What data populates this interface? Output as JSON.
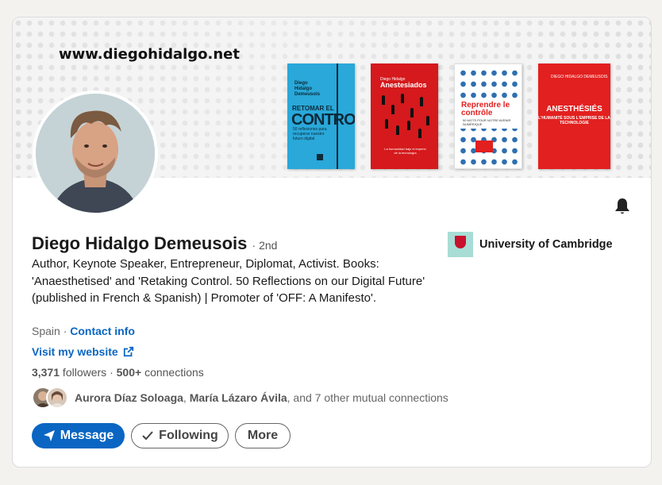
{
  "banner": {
    "website_text": "www.diegohidalgo.net",
    "books": [
      {
        "author": "Diego Hidalgo Demeusois",
        "title_top": "RETOMAR EL",
        "title_big": "CONTROL",
        "subtitle": "50 reflexiones para recuperar nuestro futuro digital"
      },
      {
        "author": "Diego Hidalgo",
        "title": "Anestesiados",
        "subtitle": "La humanidad bajo el imperio de la tecnología"
      },
      {
        "title": "Reprendre le contrôle",
        "subtitle": "50 MOTS POUR NOTRE AVENIR NUMÉRIQUE"
      },
      {
        "author": "DIEGO HIDALGO DEMEUSOIS",
        "title": "ANESTHÉSIÉS",
        "subtitle": "L'HUMANITÉ SOUS L'EMPRISE DE LA TECHNOLOGIE"
      }
    ]
  },
  "profile": {
    "name": "Diego Hidalgo Demeusois",
    "degree": "· 2nd",
    "headline": "Author, Keynote Speaker, Entrepreneur, Diplomat, Activist. Books: 'Anaesthetised' and 'Retaking Control. 50 Reflections on our Digital Future' (published in French & Spanish) | Promoter of 'OFF: A Manifesto'.",
    "location": "Spain",
    "separator": " · ",
    "contact_info": "Contact info",
    "website_link": "Visit my website",
    "followers_count": "3,371",
    "followers_label": " followers",
    "stats_sep": "  · ",
    "connections_count": "500+",
    "connections_label": " connections"
  },
  "education": {
    "school": "University of Cambridge"
  },
  "mutual": {
    "name1": "Aurora Díaz Soloaga",
    "sep": ", ",
    "name2": "María Lázaro Ávila",
    "rest": ", and 7 other mutual connections"
  },
  "actions": {
    "message": "Message",
    "following": "Following",
    "more": "More"
  },
  "colors": {
    "primary": "#0a66c2",
    "text": "#191919",
    "muted": "#666666"
  },
  "icons": [
    "bell-icon",
    "external-link-icon",
    "send-icon",
    "check-icon"
  ]
}
